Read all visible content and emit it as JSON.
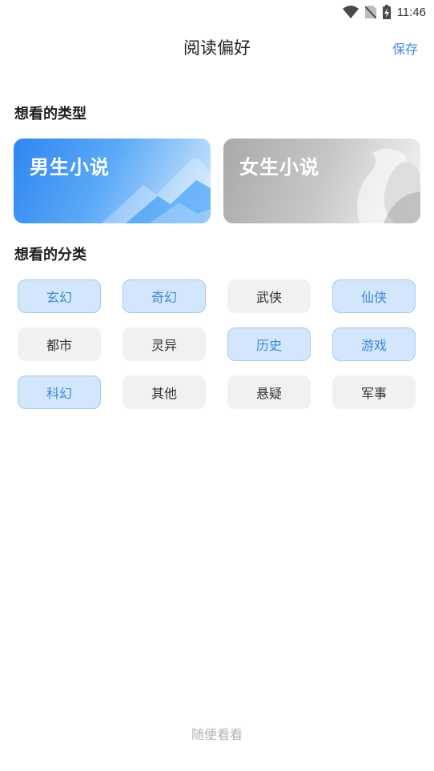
{
  "status_bar": {
    "time": "11:46",
    "icons": [
      "wifi-icon",
      "no-sim-icon",
      "battery-charging-icon"
    ]
  },
  "header": {
    "title": "阅读偏好",
    "save_label": "保存"
  },
  "type_section": {
    "title": "想看的类型",
    "cards": [
      {
        "label": "男生小说",
        "theme": "blue",
        "accent": "#2f86f0"
      },
      {
        "label": "女生小说",
        "theme": "gray",
        "accent": "#b5b5b5"
      }
    ]
  },
  "category_section": {
    "title": "想看的分类",
    "items": [
      {
        "label": "玄幻",
        "selected": true
      },
      {
        "label": "奇幻",
        "selected": true
      },
      {
        "label": "武侠",
        "selected": false
      },
      {
        "label": "仙侠",
        "selected": true
      },
      {
        "label": "都市",
        "selected": false
      },
      {
        "label": "灵异",
        "selected": false
      },
      {
        "label": "历史",
        "selected": true
      },
      {
        "label": "游戏",
        "selected": true
      },
      {
        "label": "科幻",
        "selected": true
      },
      {
        "label": "其他",
        "selected": false
      },
      {
        "label": "悬疑",
        "selected": false
      },
      {
        "label": "军事",
        "selected": false
      }
    ]
  },
  "footer": {
    "random_label": "随便看看"
  },
  "colors": {
    "accent": "#3d8be0",
    "chip_selected_bg": "#d3e6fb",
    "chip_bg": "#f1f1f1"
  }
}
